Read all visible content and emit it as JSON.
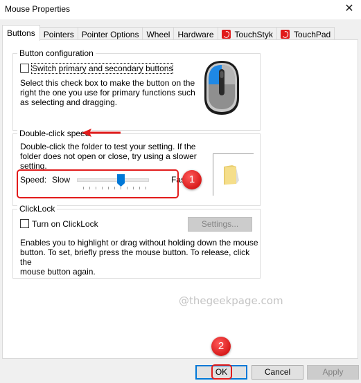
{
  "window": {
    "title": "Mouse Properties",
    "close_icon": "close-icon"
  },
  "tabs": [
    {
      "label": "Buttons",
      "active": true
    },
    {
      "label": "Pointers"
    },
    {
      "label": "Pointer Options"
    },
    {
      "label": "Wheel"
    },
    {
      "label": "Hardware"
    },
    {
      "label": "TouchStyk",
      "icon": "touchstyk-icon"
    },
    {
      "label": "TouchPad",
      "icon": "touchpad-icon"
    }
  ],
  "button_configuration": {
    "title": "Button configuration",
    "checkbox_label": "Switch primary and secondary buttons",
    "checked": false,
    "description_lines": [
      "Select this check box to make the button on the",
      "right the one you use for primary functions such",
      "as selecting and dragging."
    ],
    "image": "mouse-icon"
  },
  "double_click_speed": {
    "title": "Double-click speed",
    "description_lines": [
      "Double-click the folder to test your setting. If the",
      "folder does not open or close, try using a slower",
      "setting."
    ],
    "speed_label": "Speed:",
    "slow_label": "Slow",
    "fast_label": "Fast",
    "slider": {
      "min": 0,
      "max": 10,
      "value": 6
    },
    "test_folder": "folder-icon"
  },
  "click_lock": {
    "title": "ClickLock",
    "checkbox_label": "Turn on ClickLock",
    "checked": false,
    "settings_button": "Settings...",
    "description_lines": [
      "Enables you to highlight or drag without holding down the mouse",
      "button. To set, briefly press the mouse button. To release, click the",
      "mouse button again."
    ]
  },
  "watermark": "@thegeekpage.com",
  "annotations": [
    {
      "number": "1"
    },
    {
      "number": "2"
    }
  ],
  "footer": {
    "ok": "OK",
    "cancel": "Cancel",
    "apply": "Apply"
  },
  "colors": {
    "accent": "#0078d7",
    "annotation": "#e21b1b"
  }
}
